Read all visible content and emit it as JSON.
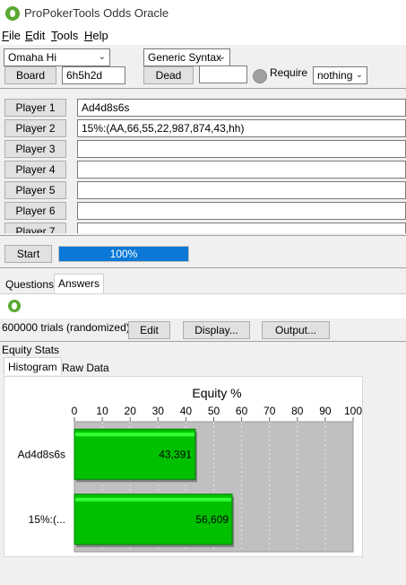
{
  "window": {
    "title": "ProPokerTools Odds Oracle"
  },
  "menu": [
    {
      "label": "File",
      "mnemonic": "F",
      "rest": "ile"
    },
    {
      "label": "Edit",
      "mnemonic": "E",
      "rest": "dit"
    },
    {
      "label": "Tools",
      "mnemonic": "T",
      "rest": "ools"
    },
    {
      "label": "Help",
      "mnemonic": "H",
      "rest": "elp"
    }
  ],
  "controls": {
    "game": "Omaha Hi",
    "syntax": "Generic Syntax",
    "board_button": "Board",
    "board_value": "6h5h2d",
    "dead_button": "Dead",
    "dead_value": "",
    "require_label": "Require",
    "require_value": "nothing"
  },
  "players": [
    {
      "label": "Player 1",
      "hand": "Ad4d8s6s"
    },
    {
      "label": "Player 2",
      "hand": "15%:(AA,66,55,22,987,874,43,hh)"
    },
    {
      "label": "Player 3",
      "hand": ""
    },
    {
      "label": "Player 4",
      "hand": ""
    },
    {
      "label": "Player 5",
      "hand": ""
    },
    {
      "label": "Player 6",
      "hand": ""
    },
    {
      "label": "Player 7",
      "hand": ""
    }
  ],
  "run": {
    "start_label": "Start",
    "progress_text": "100%",
    "progress_value": 1.0
  },
  "tabs": {
    "questions": "Questions",
    "answers": "Answers"
  },
  "results": {
    "trials_text": "600000 trials (randomized)",
    "edit_label": "Edit",
    "display_label": "Display...",
    "output_label": "Output..."
  },
  "equity": {
    "section_label": "Equity Stats",
    "tab_histogram": "Histogram",
    "tab_raw": "Raw Data"
  },
  "colors": {
    "bar_green": "#00c000",
    "bar_green_light": "#33ff33",
    "progress_blue": "#0b78d7",
    "plot_bg": "#c0c0c0"
  },
  "chart_data": {
    "type": "bar",
    "orientation": "horizontal",
    "title": "Equity %",
    "categories": [
      "Ad4d8s6s",
      "15%:(..."
    ],
    "values": [
      43.391,
      56.609
    ],
    "value_labels": [
      "43,391",
      "56,609"
    ],
    "xlim": [
      0,
      100
    ],
    "xticks": [
      "0",
      "10",
      "20",
      "30",
      "40",
      "50",
      "60",
      "70",
      "80",
      "90",
      "100"
    ],
    "tick_values": [
      0,
      10,
      20,
      30,
      40,
      50,
      60,
      70,
      80,
      90,
      100
    ],
    "grid": true
  }
}
